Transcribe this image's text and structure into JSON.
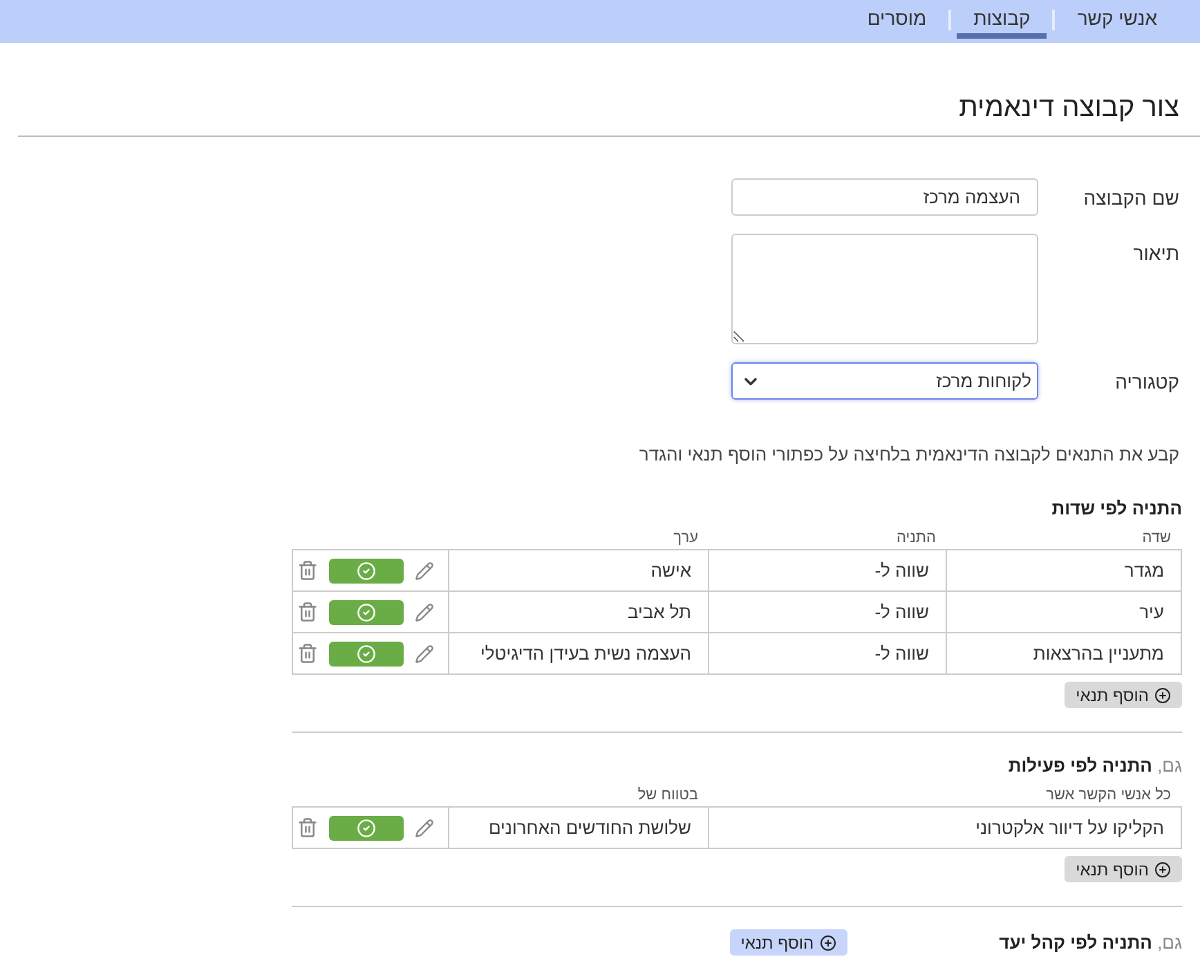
{
  "tabs": [
    {
      "label": "אנשי קשר",
      "selected": false
    },
    {
      "label": "קבוצות",
      "selected": true
    },
    {
      "label": "מוסרים",
      "selected": false
    }
  ],
  "title": "צור קבוצה דינאמית",
  "form": {
    "name_label": "שם הקבוצה",
    "name_value": "העצמה מרכז",
    "description_label": "תיאור",
    "category_label": "קטגוריה",
    "category_value": "לקוחות מרכז"
  },
  "instructions": "קבע את התנאים לקבוצה הדינאמית בלחיצה על כפתורי הוסף תנאי והגדר",
  "sections": [
    {
      "heading": "**התניה לפי שדות**",
      "columns": [
        "שדה",
        "התניה",
        "ערך"
      ],
      "rows": [
        {
          "cells": [
            "מגדר",
            "שווה ל-",
            "אישה"
          ]
        },
        {
          "cells": [
            "עיר",
            "שווה ל-",
            "תל אביב"
          ]
        },
        {
          "cells": [
            "מתעניין בהרצאות",
            "שווה ל-",
            "העצמה נשית בעידן הדיגיטלי"
          ]
        }
      ],
      "add_button": "הוסף תנאי"
    },
    {
      "heading": "גם, **התניה לפי פעילות**",
      "columns": [
        "כל אנשי הקשר אשר",
        "בטווח של"
      ],
      "rows": [
        {
          "cells": [
            "הקליקו על דיוור אלקטרוני",
            "שלושת החודשים האחרונים"
          ]
        }
      ],
      "add_button": "הוסף תנאי"
    },
    {
      "heading": "גם, **התניה לפי קהל יעד**",
      "add_button": "הוסף תנאי"
    }
  ]
}
